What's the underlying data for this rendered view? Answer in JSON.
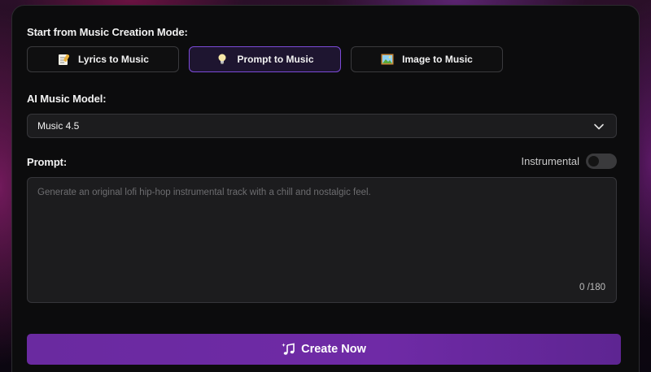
{
  "mode_section": {
    "label": "Start from Music Creation Mode:",
    "modes": [
      {
        "label": "Lyrics to Music",
        "icon": "memo-icon",
        "active": false
      },
      {
        "label": "Prompt to Music",
        "icon": "lightbulb-icon",
        "active": true
      },
      {
        "label": "Image to Music",
        "icon": "framed-picture-icon",
        "active": false
      }
    ]
  },
  "model_section": {
    "label": "AI Music Model:",
    "selected": "Music 4.5"
  },
  "prompt_section": {
    "label": "Prompt:",
    "instrumental_label": "Instrumental",
    "instrumental_on": false,
    "placeholder": "Generate an original lofi hip-hop instrumental track with a chill and nostalgic feel.",
    "value": "",
    "counter": "0 /180"
  },
  "create_button": {
    "label": "Create Now",
    "icon": "music-sparkle-icon"
  },
  "colors": {
    "accent": "#7c4ad8",
    "button": "#6a2aa0",
    "panel": "#0c0c0d"
  }
}
